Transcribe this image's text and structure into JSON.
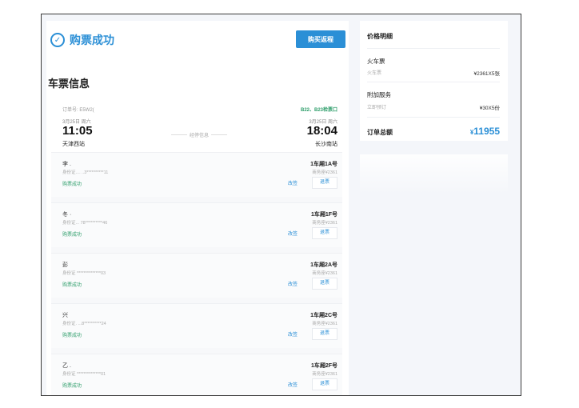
{
  "status": {
    "text": "购票成功"
  },
  "buy_return_label": "购买返程",
  "section_title": "车票信息",
  "trip": {
    "order_no": "订单号: E5W2(",
    "windows": "B22、B23检票口",
    "depart": {
      "date": "3月25日 周六",
      "time": "11:05",
      "station": "天津西站"
    },
    "route_label": "经停信息",
    "arrive": {
      "date": "3月25日 周六",
      "time": "18:04",
      "station": "长沙南站"
    }
  },
  "passengers": [
    {
      "name": "李 .",
      "id": "身份证....  ..3**********11",
      "status": "购票成功",
      "seat": "1车厢1A号",
      "type": "商务座¥2361",
      "change": "改签",
      "refund": "退票"
    },
    {
      "name": "冬 ·",
      "id": "身份证...  78**********46",
      "status": "购票成功",
      "seat": "1车厢1F号",
      "type": "商务座¥2361",
      "change": "改签",
      "refund": "退票"
    },
    {
      "name": "彭",
      "id": "身份证   **************03",
      "status": "购票成功",
      "seat": "1车厢2A号",
      "type": "商务座¥2361",
      "change": "改签",
      "refund": "退票"
    },
    {
      "name": "兴",
      "id": "身份证.  ...8**********24",
      "status": "购票成功",
      "seat": "1车厢2C号",
      "type": "商务座¥2361",
      "change": "改签",
      "refund": "退票"
    },
    {
      "name": "乙 .",
      "id": "身份证    **************01",
      "status": "购票成功",
      "seat": "1车厢2F号",
      "type": "商务座¥2361",
      "change": "改签",
      "refund": "退票"
    }
  ],
  "price": {
    "title": "价格明细",
    "train": {
      "label": "火车票",
      "sub": "火车票",
      "value": "¥2361X5张"
    },
    "addon": {
      "label": "附加服务",
      "sub": "立即预订",
      "value": "¥30X5份"
    },
    "total": {
      "label": "订单总额",
      "currency": "¥",
      "amount": "11955"
    }
  }
}
